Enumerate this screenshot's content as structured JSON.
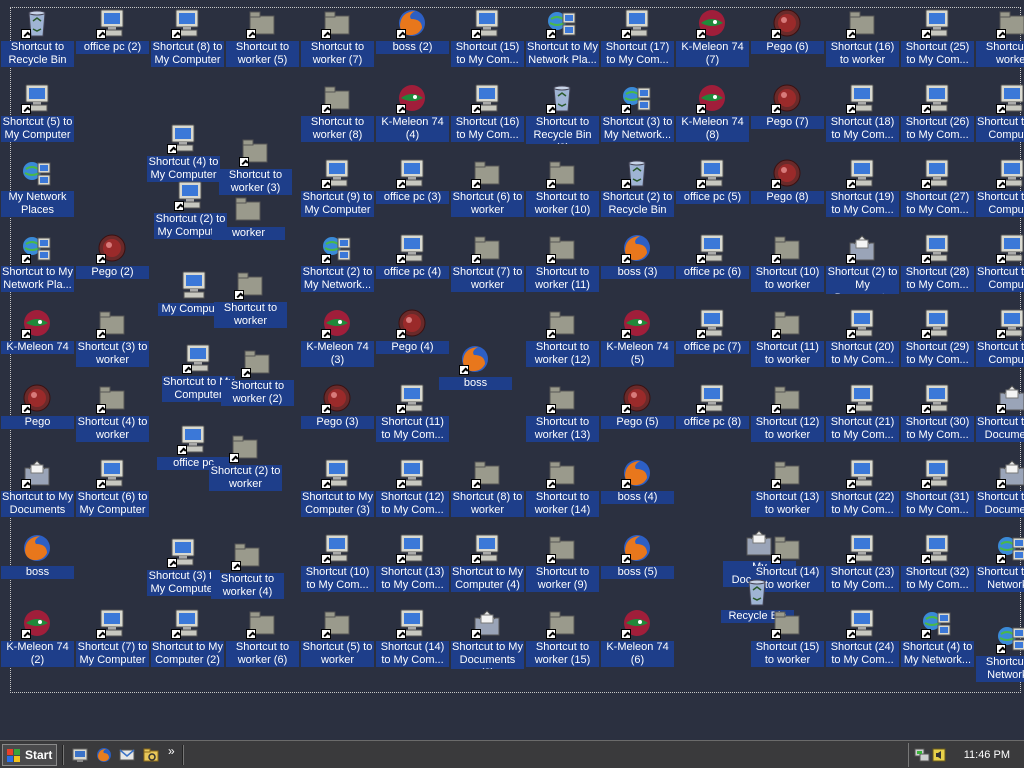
{
  "desktop": {
    "icons": [
      {
        "label": "Shortcut to Recycle Bin",
        "type": "recycle",
        "shortcut": true
      },
      {
        "label": "office pc (2)",
        "type": "pc",
        "shortcut": true
      },
      {
        "label": "Shortcut (8) to My Computer",
        "type": "pc",
        "shortcut": true
      },
      {
        "label": "Shortcut to worker (5)",
        "type": "folder",
        "shortcut": true
      },
      {
        "label": "Shortcut to worker (7)",
        "type": "folder",
        "shortcut": true
      },
      {
        "label": "boss (2)",
        "type": "firefox",
        "shortcut": true
      },
      {
        "label": "Shortcut (15) to My Com...",
        "type": "pc",
        "shortcut": true
      },
      {
        "label": "Shortcut to My Network Pla...",
        "type": "network",
        "shortcut": true
      },
      {
        "label": "Shortcut (17) to My Com...",
        "type": "pc",
        "shortcut": true
      },
      {
        "label": "K-Meleon 74 (7)",
        "type": "kmeleon",
        "shortcut": true
      },
      {
        "label": "Pego (6)",
        "type": "pego",
        "shortcut": true
      },
      {
        "label": "Shortcut (16) to worker",
        "type": "folder",
        "shortcut": true
      },
      {
        "label": "Shortcut (25) to My Com...",
        "type": "pc",
        "shortcut": true
      },
      {
        "label": "Shortcut to worker",
        "type": "folder",
        "shortcut": true
      },
      {
        "label": "Shortcut (5) to My Computer",
        "type": "pc",
        "shortcut": true
      },
      {
        "label": "Shortcut to worker (8)",
        "type": "folder",
        "shortcut": true
      },
      {
        "label": "K-Meleon 74 (4)",
        "type": "kmeleon",
        "shortcut": true
      },
      {
        "label": "Shortcut (16) to My Com...",
        "type": "pc",
        "shortcut": true
      },
      {
        "label": "Shortcut to Recycle Bin (2)",
        "type": "recycle",
        "shortcut": true
      },
      {
        "label": "Shortcut (3) to My Network...",
        "type": "network",
        "shortcut": true
      },
      {
        "label": "K-Meleon 74 (8)",
        "type": "kmeleon",
        "shortcut": true
      },
      {
        "label": "Pego (7)",
        "type": "pego",
        "shortcut": true
      },
      {
        "label": "Shortcut (18) to My Com...",
        "type": "pc",
        "shortcut": true
      },
      {
        "label": "Shortcut (26) to My Com...",
        "type": "pc",
        "shortcut": true
      },
      {
        "label": "Shortcut to My Computer",
        "type": "pc",
        "shortcut": true
      },
      {
        "label": "Shortcut (4) to My Computer",
        "type": "pc",
        "shortcut": true
      },
      {
        "label": "Shortcut to worker (3)",
        "type": "folder",
        "shortcut": true
      },
      {
        "label": "My Network Places",
        "type": "network",
        "shortcut": false
      },
      {
        "label": "Shortcut (2) to My Computer",
        "type": "pc",
        "shortcut": true
      },
      {
        "label": "worker",
        "type": "folder",
        "shortcut": false
      },
      {
        "label": "Shortcut (9) to My Computer",
        "type": "pc",
        "shortcut": true
      },
      {
        "label": "office pc (3)",
        "type": "pc",
        "shortcut": true
      },
      {
        "label": "Shortcut (6) to worker",
        "type": "folder",
        "shortcut": true
      },
      {
        "label": "Shortcut to worker (10)",
        "type": "folder",
        "shortcut": true
      },
      {
        "label": "Shortcut (2) to Recycle Bin",
        "type": "recycle",
        "shortcut": true
      },
      {
        "label": "office pc (5)",
        "type": "pc",
        "shortcut": true
      },
      {
        "label": "Pego (8)",
        "type": "pego",
        "shortcut": true
      },
      {
        "label": "Shortcut (19) to My Com...",
        "type": "pc",
        "shortcut": true
      },
      {
        "label": "Shortcut (27) to My Com...",
        "type": "pc",
        "shortcut": true
      },
      {
        "label": "Shortcut to My Computer",
        "type": "pc",
        "shortcut": true
      },
      {
        "label": "Shortcut to My Network Pla...",
        "type": "network",
        "shortcut": true
      },
      {
        "label": "Pego (2)",
        "type": "pego",
        "shortcut": true
      },
      {
        "label": "My Computer",
        "type": "pc",
        "shortcut": false
      },
      {
        "label": "Shortcut to worker",
        "type": "folder",
        "shortcut": true
      },
      {
        "label": "Shortcut (2) to My Network...",
        "type": "network",
        "shortcut": true
      },
      {
        "label": "office pc (4)",
        "type": "pc",
        "shortcut": true
      },
      {
        "label": "Shortcut (7) to worker",
        "type": "folder",
        "shortcut": true
      },
      {
        "label": "Shortcut to worker (11)",
        "type": "folder",
        "shortcut": true
      },
      {
        "label": "boss (3)",
        "type": "firefox",
        "shortcut": true
      },
      {
        "label": "office pc (6)",
        "type": "pc",
        "shortcut": true
      },
      {
        "label": "Shortcut (10) to worker",
        "type": "folder",
        "shortcut": true
      },
      {
        "label": "Shortcut (2) to My Documents",
        "type": "docs",
        "shortcut": true
      },
      {
        "label": "Shortcut (28) to My Com...",
        "type": "pc",
        "shortcut": true
      },
      {
        "label": "Shortcut to My Computer",
        "type": "pc",
        "shortcut": true
      },
      {
        "label": "K-Meleon 74",
        "type": "kmeleon",
        "shortcut": true
      },
      {
        "label": "Shortcut (3) to worker",
        "type": "folder",
        "shortcut": true
      },
      {
        "label": "Shortcut to My Computer",
        "type": "pc",
        "shortcut": true
      },
      {
        "label": "Shortcut to worker (2)",
        "type": "folder",
        "shortcut": true
      },
      {
        "label": "K-Meleon 74 (3)",
        "type": "kmeleon",
        "shortcut": true
      },
      {
        "label": "Pego (4)",
        "type": "pego",
        "shortcut": true
      },
      {
        "label": "boss",
        "type": "firefox",
        "shortcut": true
      },
      {
        "label": "Shortcut to worker (12)",
        "type": "folder",
        "shortcut": true
      },
      {
        "label": "K-Meleon 74 (5)",
        "type": "kmeleon",
        "shortcut": true
      },
      {
        "label": "office pc (7)",
        "type": "pc",
        "shortcut": true
      },
      {
        "label": "Shortcut (11) to worker",
        "type": "folder",
        "shortcut": true
      },
      {
        "label": "Shortcut (20) to My Com...",
        "type": "pc",
        "shortcut": true
      },
      {
        "label": "Shortcut (29) to My Com...",
        "type": "pc",
        "shortcut": true
      },
      {
        "label": "Shortcut to My Computer",
        "type": "pc",
        "shortcut": true
      },
      {
        "label": "Pego",
        "type": "pego",
        "shortcut": true
      },
      {
        "label": "Shortcut (4) to worker",
        "type": "folder",
        "shortcut": true
      },
      {
        "label": "office pc",
        "type": "pc",
        "shortcut": true
      },
      {
        "label": "Shortcut (2) to worker",
        "type": "folder",
        "shortcut": true
      },
      {
        "label": "Pego (3)",
        "type": "pego",
        "shortcut": true
      },
      {
        "label": "Shortcut (11) to My Com...",
        "type": "pc",
        "shortcut": true
      },
      {
        "label": "Shortcut to worker (13)",
        "type": "folder",
        "shortcut": true
      },
      {
        "label": "Pego (5)",
        "type": "pego",
        "shortcut": true
      },
      {
        "label": "office pc (8)",
        "type": "pc",
        "shortcut": true
      },
      {
        "label": "Shortcut (12) to worker",
        "type": "folder",
        "shortcut": true
      },
      {
        "label": "Shortcut (21) to My Com...",
        "type": "pc",
        "shortcut": true
      },
      {
        "label": "Shortcut (30) to My Com...",
        "type": "pc",
        "shortcut": true
      },
      {
        "label": "Shortcut to My Documents",
        "type": "docs",
        "shortcut": true
      },
      {
        "label": "Shortcut to My Documents",
        "type": "docs",
        "shortcut": true
      },
      {
        "label": "Shortcut (6) to My Computer",
        "type": "pc",
        "shortcut": true
      },
      {
        "label": "Shortcut to My Computer (3)",
        "type": "pc",
        "shortcut": true
      },
      {
        "label": "Shortcut (12) to My Com...",
        "type": "pc",
        "shortcut": true
      },
      {
        "label": "Shortcut (8) to worker",
        "type": "folder",
        "shortcut": true
      },
      {
        "label": "Shortcut to worker (14)",
        "type": "folder",
        "shortcut": true
      },
      {
        "label": "boss (4)",
        "type": "firefox",
        "shortcut": true
      },
      {
        "label": "Shortcut (13) to worker",
        "type": "folder",
        "shortcut": true
      },
      {
        "label": "Shortcut (22) to My Com...",
        "type": "pc",
        "shortcut": true
      },
      {
        "label": "Shortcut (31) to My Com...",
        "type": "pc",
        "shortcut": true
      },
      {
        "label": "Shortcut to My Documents",
        "type": "docs",
        "shortcut": true
      },
      {
        "label": "boss",
        "type": "firefox",
        "shortcut": false
      },
      {
        "label": "Shortcut (3) to My Computer",
        "type": "pc",
        "shortcut": true
      },
      {
        "label": "Shortcut to worker (4)",
        "type": "folder",
        "shortcut": true
      },
      {
        "label": "Shortcut (10) to My Com...",
        "type": "pc",
        "shortcut": true
      },
      {
        "label": "Shortcut (13) to My Com...",
        "type": "pc",
        "shortcut": true
      },
      {
        "label": "Shortcut to My Computer (4)",
        "type": "pc",
        "shortcut": true
      },
      {
        "label": "Shortcut to worker (9)",
        "type": "folder",
        "shortcut": true
      },
      {
        "label": "boss (5)",
        "type": "firefox",
        "shortcut": true
      },
      {
        "label": "My Documents",
        "type": "docs",
        "shortcut": false
      },
      {
        "label": "Shortcut (14) to worker",
        "type": "folder",
        "shortcut": true
      },
      {
        "label": "Shortcut (23) to My Com...",
        "type": "pc",
        "shortcut": true
      },
      {
        "label": "Shortcut (32) to My Com...",
        "type": "pc",
        "shortcut": true
      },
      {
        "label": "Shortcut to My Network P",
        "type": "network",
        "shortcut": true
      },
      {
        "label": "K-Meleon 74 (2)",
        "type": "kmeleon",
        "shortcut": true
      },
      {
        "label": "Shortcut (7) to My Computer",
        "type": "pc",
        "shortcut": true
      },
      {
        "label": "Shortcut to My Computer (2)",
        "type": "pc",
        "shortcut": true
      },
      {
        "label": "Shortcut to worker (6)",
        "type": "folder",
        "shortcut": true
      },
      {
        "label": "Shortcut (5) to worker",
        "type": "folder",
        "shortcut": true
      },
      {
        "label": "Shortcut (14) to My Com...",
        "type": "pc",
        "shortcut": true
      },
      {
        "label": "Shortcut to My Documents (2)",
        "type": "docs",
        "shortcut": true
      },
      {
        "label": "Shortcut to worker (15)",
        "type": "folder",
        "shortcut": true
      },
      {
        "label": "K-Meleon 74 (6)",
        "type": "kmeleon",
        "shortcut": true
      },
      {
        "label": "Recycle Bin",
        "type": "recycle",
        "shortcut": false
      },
      {
        "label": "Shortcut (15) to worker",
        "type": "folder",
        "shortcut": true
      },
      {
        "label": "Shortcut (24) to My Com...",
        "type": "pc",
        "shortcut": true
      },
      {
        "label": "Shortcut (4) to My Network...",
        "type": "network",
        "shortcut": true
      },
      {
        "label": "Shortcut to Network P",
        "type": "network",
        "shortcut": true
      }
    ]
  },
  "taskbar": {
    "start_label": "Start",
    "quick_launch": [
      "desktop-icon",
      "firefox-icon",
      "outlook-icon",
      "explorer-icon"
    ],
    "more_label": "»",
    "clock": "11:46 PM"
  },
  "colors": {
    "desktop_bg": "#2b3040",
    "label_highlight": "#1e3e8a",
    "taskbar_bg": "#3a3a3c"
  }
}
